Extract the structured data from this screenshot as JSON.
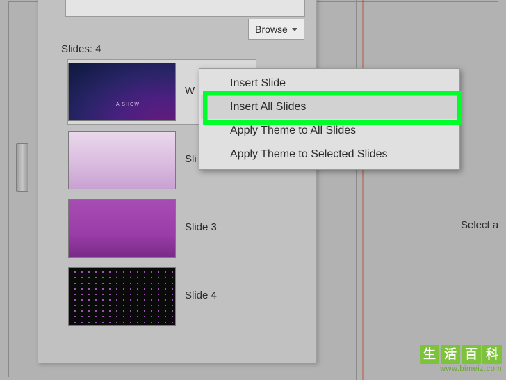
{
  "browse": {
    "label": "Browse"
  },
  "slides_header": "Slides: 4",
  "slides": [
    {
      "caption": "W",
      "thumb_subtext": "A SHOW"
    },
    {
      "caption": "Sli"
    },
    {
      "caption": "Slide 3"
    },
    {
      "caption": "Slide 4"
    }
  ],
  "context_menu": {
    "items": [
      "Insert Slide",
      "Insert All Slides",
      "Apply Theme to All Slides",
      "Apply Theme to Selected Slides"
    ]
  },
  "right_pane": {
    "select_text": "Select a"
  },
  "watermark": {
    "chars": [
      "生",
      "活",
      "百",
      "科"
    ],
    "url": "www.bimeiz.com"
  }
}
